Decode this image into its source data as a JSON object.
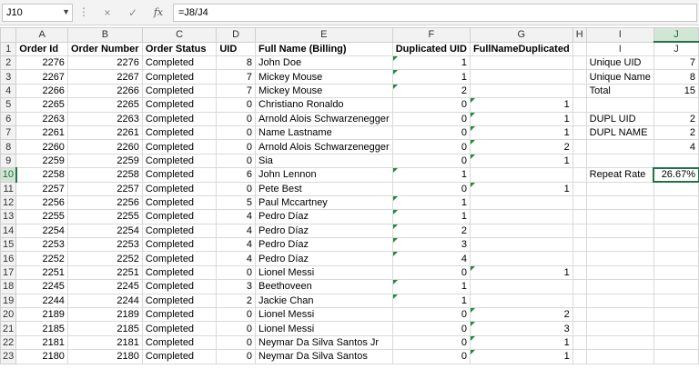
{
  "formula_bar": {
    "name_box": "J10",
    "formula": "=J8/J4",
    "cancel_icon": "×",
    "enter_icon": "✓",
    "fx_label": "fx"
  },
  "columns": [
    "A",
    "B",
    "C",
    "D",
    "E",
    "F",
    "G",
    "H",
    "I",
    "J"
  ],
  "active_cell": "J10",
  "rows": [
    {
      "n": "1",
      "A": "Order Id",
      "B": "Order Number",
      "C": "Order Status",
      "D": "UID",
      "E": "Full Name (Billing)",
      "F": "Duplicated UID",
      "G": "FullNameDuplicated",
      "H": "",
      "I": "I",
      "J": "J"
    },
    {
      "n": "2",
      "A": "2276",
      "B": "2276",
      "C": "Completed",
      "D": "8",
      "E": "John Doe",
      "F": "1",
      "G": "",
      "H": "",
      "I": "Unique UID",
      "J": "7"
    },
    {
      "n": "3",
      "A": "2267",
      "B": "2267",
      "C": "Completed",
      "D": "7",
      "E": "Mickey Mouse",
      "F": "1",
      "G": "",
      "H": "",
      "I": "Unique Name",
      "J": "8"
    },
    {
      "n": "4",
      "A": "2266",
      "B": "2266",
      "C": "Completed",
      "D": "7",
      "E": "Mickey Mouse",
      "F": "2",
      "G": "",
      "H": "",
      "I": "Total",
      "J": "15"
    },
    {
      "n": "5",
      "A": "2265",
      "B": "2265",
      "C": "Completed",
      "D": "0",
      "E": "Christiano Ronaldo",
      "F": "0",
      "G": "1",
      "H": "",
      "I": "",
      "J": ""
    },
    {
      "n": "6",
      "A": "2263",
      "B": "2263",
      "C": "Completed",
      "D": "0",
      "E": "Arnold Alois Schwarzenegger",
      "F": "0",
      "G": "1",
      "H": "",
      "I": "DUPL UID",
      "J": "2"
    },
    {
      "n": "7",
      "A": "2261",
      "B": "2261",
      "C": "Completed",
      "D": "0",
      "E": "Name Lastname",
      "F": "0",
      "G": "1",
      "H": "",
      "I": "DUPL NAME",
      "J": "2"
    },
    {
      "n": "8",
      "A": "2260",
      "B": "2260",
      "C": "Completed",
      "D": "0",
      "E": "Arnold Alois Schwarzenegger",
      "F": "0",
      "G": "2",
      "H": "",
      "I": "",
      "J": "4"
    },
    {
      "n": "9",
      "A": "2259",
      "B": "2259",
      "C": "Completed",
      "D": "0",
      "E": "Sia",
      "F": "0",
      "G": "1",
      "H": "",
      "I": "",
      "J": ""
    },
    {
      "n": "10",
      "A": "2258",
      "B": "2258",
      "C": "Completed",
      "D": "6",
      "E": "John Lennon",
      "F": "1",
      "G": "",
      "H": "",
      "I": "Repeat Rate",
      "J": "26.67%"
    },
    {
      "n": "11",
      "A": "2257",
      "B": "2257",
      "C": "Completed",
      "D": "0",
      "E": "Pete Best",
      "F": "0",
      "G": "1",
      "H": "",
      "I": "",
      "J": ""
    },
    {
      "n": "12",
      "A": "2256",
      "B": "2256",
      "C": "Completed",
      "D": "5",
      "E": "Paul Mccartney",
      "F": "1",
      "G": "",
      "H": "",
      "I": "",
      "J": ""
    },
    {
      "n": "13",
      "A": "2255",
      "B": "2255",
      "C": "Completed",
      "D": "4",
      "E": "Pedro Díaz",
      "F": "1",
      "G": "",
      "H": "",
      "I": "",
      "J": ""
    },
    {
      "n": "14",
      "A": "2254",
      "B": "2254",
      "C": "Completed",
      "D": "4",
      "E": "Pedro Díaz",
      "F": "2",
      "G": "",
      "H": "",
      "I": "",
      "J": ""
    },
    {
      "n": "15",
      "A": "2253",
      "B": "2253",
      "C": "Completed",
      "D": "4",
      "E": "Pedro Díaz",
      "F": "3",
      "G": "",
      "H": "",
      "I": "",
      "J": ""
    },
    {
      "n": "16",
      "A": "2252",
      "B": "2252",
      "C": "Completed",
      "D": "4",
      "E": "Pedro Díaz",
      "F": "4",
      "G": "",
      "H": "",
      "I": "",
      "J": ""
    },
    {
      "n": "17",
      "A": "2251",
      "B": "2251",
      "C": "Completed",
      "D": "0",
      "E": "Lionel Messi",
      "F": "0",
      "G": "1",
      "H": "",
      "I": "",
      "J": ""
    },
    {
      "n": "18",
      "A": "2245",
      "B": "2245",
      "C": "Completed",
      "D": "3",
      "E": "Beethoveen",
      "F": "1",
      "G": "",
      "H": "",
      "I": "",
      "J": ""
    },
    {
      "n": "19",
      "A": "2244",
      "B": "2244",
      "C": "Completed",
      "D": "2",
      "E": "Jackie Chan",
      "F": "1",
      "G": "",
      "H": "",
      "I": "",
      "J": ""
    },
    {
      "n": "20",
      "A": "2189",
      "B": "2189",
      "C": "Completed",
      "D": "0",
      "E": "Lionel Messi",
      "F": "0",
      "G": "2",
      "H": "",
      "I": "",
      "J": ""
    },
    {
      "n": "21",
      "A": "2185",
      "B": "2185",
      "C": "Completed",
      "D": "0",
      "E": "Lionel Messi",
      "F": "0",
      "G": "3",
      "H": "",
      "I": "",
      "J": ""
    },
    {
      "n": "22",
      "A": "2181",
      "B": "2181",
      "C": "Completed",
      "D": "0",
      "E": "Neymar Da Silva Santos Jr",
      "F": "0",
      "G": "1",
      "H": "",
      "I": "",
      "J": ""
    },
    {
      "n": "23",
      "A": "2180",
      "B": "2180",
      "C": "Completed",
      "D": "0",
      "E": "Neymar Da Silva Santos",
      "F": "0",
      "G": "1",
      "H": "",
      "I": "",
      "J": ""
    }
  ]
}
